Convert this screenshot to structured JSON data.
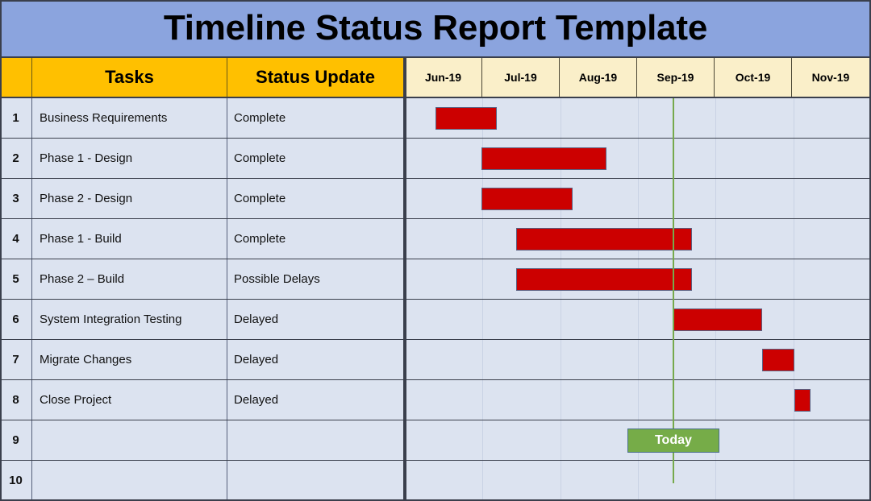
{
  "title": "Timeline Status Report Template",
  "colors": {
    "title_bar": "#8BA4DE",
    "header_gold": "#FFC000",
    "header_cream": "#FAEFC9",
    "row_fill": "#DCE3F0",
    "bar_red": "#CC0000",
    "today_green": "#76AC48",
    "today_line": "#76A94C",
    "border": "#3A3F4C"
  },
  "header": {
    "num_label": "",
    "tasks_label": "Tasks",
    "status_label": "Status Update"
  },
  "months": [
    "Jun-19",
    "Jul-19",
    "Aug-19",
    "Sep-19",
    "Oct-19",
    "Nov-19"
  ],
  "today": {
    "label": "Today",
    "position_pct": 57.6
  },
  "rows": [
    {
      "num": "1",
      "task": "Business Requirements",
      "status": "Complete"
    },
    {
      "num": "2",
      "task": "Phase 1 - Design",
      "status": "Complete"
    },
    {
      "num": "3",
      "task": "Phase 2 - Design",
      "status": "Complete"
    },
    {
      "num": "4",
      "task": "Phase 1 - Build",
      "status": "Complete"
    },
    {
      "num": "5",
      "task": "Phase 2 – Build",
      "status": "Possible Delays"
    },
    {
      "num": "6",
      "task": "System Integration Testing",
      "status": "Delayed"
    },
    {
      "num": "7",
      "task": "Migrate Changes",
      "status": "Delayed"
    },
    {
      "num": "8",
      "task": "Close Project",
      "status": "Delayed"
    },
    {
      "num": "9",
      "task": "",
      "status": ""
    },
    {
      "num": "10",
      "task": "",
      "status": ""
    }
  ],
  "chart_data": {
    "type": "bar",
    "title": "Timeline Status Report Template",
    "xlabel": "",
    "ylabel": "",
    "orientation": "horizontal-gantt",
    "categories": [
      "Business Requirements",
      "Phase 1 - Design",
      "Phase 2 - Design",
      "Phase 1 - Build",
      "Phase 2 – Build",
      "System Integration Testing",
      "Migrate Changes",
      "Close Project",
      "",
      ""
    ],
    "x_axis_ticks": [
      "Jun-19",
      "Jul-19",
      "Aug-19",
      "Sep-19",
      "Oct-19",
      "Nov-19"
    ],
    "axis_start_month": "Jun-19",
    "axis_end_month": "Nov-19",
    "grid": true,
    "legend": null,
    "annotations": [
      {
        "text": "Today",
        "type": "marker-line",
        "x_pct": 57.6,
        "color": "#76AC48"
      }
    ],
    "bars": [
      {
        "row": 1,
        "task": "Business Requirements",
        "status": "Complete",
        "start_pct": 6.6,
        "end_pct": 19.7,
        "start_month": "Jun-19",
        "end_month": "Jun-19",
        "color": "#CC0000"
      },
      {
        "row": 2,
        "task": "Phase 1 - Design",
        "status": "Complete",
        "start_pct": 16.4,
        "end_pct": 43.3,
        "start_month": "Jul-19",
        "end_month": "Aug-19",
        "color": "#CC0000"
      },
      {
        "row": 3,
        "task": "Phase 2 - Design",
        "status": "Complete",
        "start_pct": 16.4,
        "end_pct": 36.0,
        "start_month": "Jul-19",
        "end_month": "Aug-19",
        "color": "#CC0000"
      },
      {
        "row": 4,
        "task": "Phase 1 - Build",
        "status": "Complete",
        "start_pct": 23.9,
        "end_pct": 61.6,
        "start_month": "Jul-19",
        "end_month": "Sep-19",
        "color": "#CC0000"
      },
      {
        "row": 5,
        "task": "Phase 2 – Build",
        "status": "Possible Delays",
        "start_pct": 23.9,
        "end_pct": 61.6,
        "start_month": "Jul-19",
        "end_month": "Sep-19",
        "color": "#CC0000"
      },
      {
        "row": 6,
        "task": "System Integration Testing",
        "status": "Delayed",
        "start_pct": 57.6,
        "end_pct": 76.6,
        "start_month": "Sep-19",
        "end_month": "Oct-19",
        "color": "#CC0000"
      },
      {
        "row": 7,
        "task": "Migrate Changes",
        "status": "Delayed",
        "start_pct": 76.6,
        "end_pct": 83.6,
        "start_month": "Oct-19",
        "end_month": "Oct-19",
        "color": "#CC0000"
      },
      {
        "row": 8,
        "task": "Close Project",
        "status": "Delayed",
        "start_pct": 83.6,
        "end_pct": 87.0,
        "start_month": "Oct-19",
        "end_month": "Nov-19",
        "color": "#CC0000"
      }
    ]
  }
}
